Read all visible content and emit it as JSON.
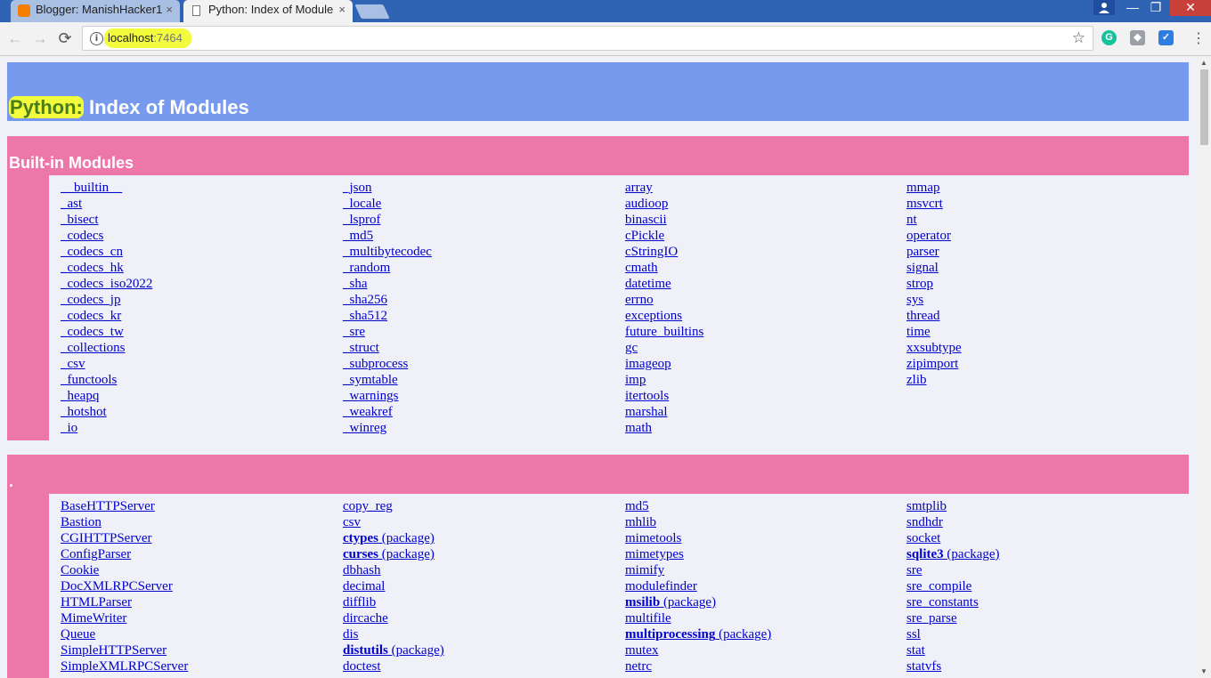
{
  "browser": {
    "tabs": [
      {
        "title": "Blogger: ManishHacker1",
        "close": "×",
        "active": false
      },
      {
        "title": "Python: Index of Module",
        "close": "×",
        "active": true
      }
    ],
    "window_controls": {
      "minimize": "—",
      "maximize": "❐",
      "close": "✕"
    },
    "url_host": "localhost",
    "url_port": ":7464",
    "nav": {
      "back": "←",
      "forward": "→",
      "reload": "⟳"
    },
    "star": "☆",
    "menu": "⋮",
    "info_glyph": "i",
    "extensions": [
      {
        "name": "grammarly-icon",
        "color": "#15c39a",
        "glyph": "G"
      },
      {
        "name": "extension-icon",
        "color": "#9aa0a6",
        "glyph": "◆"
      },
      {
        "name": "checkmark-extension-icon",
        "color": "#2f7de1",
        "glyph": "✓"
      }
    ],
    "colors": {
      "tab_strip": "#2f63b4",
      "highlight": "#f2fb3c"
    }
  },
  "page": {
    "title_highlight": "Python:",
    "title_rest": " Index of Modules",
    "colors": {
      "heading": "#7799ee",
      "section": "#ee77aa",
      "link": "#0000cc",
      "background": "#f0f0f8"
    },
    "builtin": {
      "heading": "Built-in Modules",
      "columns": [
        [
          {
            "name": "__builtin__"
          },
          {
            "name": "_ast"
          },
          {
            "name": "_bisect"
          },
          {
            "name": "_codecs"
          },
          {
            "name": "_codecs_cn"
          },
          {
            "name": "_codecs_hk"
          },
          {
            "name": "_codecs_iso2022"
          },
          {
            "name": "_codecs_jp"
          },
          {
            "name": "_codecs_kr"
          },
          {
            "name": "_codecs_tw"
          },
          {
            "name": "_collections"
          },
          {
            "name": "_csv"
          },
          {
            "name": "_functools"
          },
          {
            "name": "_heapq"
          },
          {
            "name": "_hotshot"
          },
          {
            "name": "_io"
          }
        ],
        [
          {
            "name": "_json"
          },
          {
            "name": "_locale"
          },
          {
            "name": "_lsprof"
          },
          {
            "name": "_md5"
          },
          {
            "name": "_multibytecodec"
          },
          {
            "name": "_random"
          },
          {
            "name": "_sha"
          },
          {
            "name": "_sha256"
          },
          {
            "name": "_sha512"
          },
          {
            "name": "_sre"
          },
          {
            "name": "_struct"
          },
          {
            "name": "_subprocess"
          },
          {
            "name": "_symtable"
          },
          {
            "name": "_warnings"
          },
          {
            "name": "_weakref"
          },
          {
            "name": "_winreg"
          }
        ],
        [
          {
            "name": "array"
          },
          {
            "name": "audioop"
          },
          {
            "name": "binascii"
          },
          {
            "name": "cPickle"
          },
          {
            "name": "cStringIO"
          },
          {
            "name": "cmath"
          },
          {
            "name": "datetime"
          },
          {
            "name": "errno"
          },
          {
            "name": "exceptions"
          },
          {
            "name": "future_builtins"
          },
          {
            "name": "gc"
          },
          {
            "name": "imageop"
          },
          {
            "name": "imp"
          },
          {
            "name": "itertools"
          },
          {
            "name": "marshal"
          },
          {
            "name": "math"
          }
        ],
        [
          {
            "name": "mmap"
          },
          {
            "name": "msvcrt"
          },
          {
            "name": "nt"
          },
          {
            "name": "operator"
          },
          {
            "name": "parser"
          },
          {
            "name": "signal"
          },
          {
            "name": "strop"
          },
          {
            "name": "sys"
          },
          {
            "name": "thread"
          },
          {
            "name": "time"
          },
          {
            "name": "xxsubtype"
          },
          {
            "name": "zipimport"
          },
          {
            "name": "zlib"
          }
        ]
      ]
    },
    "path_section": {
      "heading": ".",
      "package_suffix": " (package)",
      "columns": [
        [
          {
            "name": "BaseHTTPServer"
          },
          {
            "name": "Bastion"
          },
          {
            "name": "CGIHTTPServer"
          },
          {
            "name": "ConfigParser"
          },
          {
            "name": "Cookie"
          },
          {
            "name": "DocXMLRPCServer"
          },
          {
            "name": "HTMLParser"
          },
          {
            "name": "MimeWriter"
          },
          {
            "name": "Queue"
          },
          {
            "name": "SimpleHTTPServer"
          },
          {
            "name": "SimpleXMLRPCServer"
          }
        ],
        [
          {
            "name": "copy_reg"
          },
          {
            "name": "csv"
          },
          {
            "name": "ctypes",
            "pkg": true
          },
          {
            "name": "curses",
            "pkg": true
          },
          {
            "name": "dbhash"
          },
          {
            "name": "decimal"
          },
          {
            "name": "difflib"
          },
          {
            "name": "dircache"
          },
          {
            "name": "dis"
          },
          {
            "name": "distutils",
            "pkg": true
          },
          {
            "name": "doctest"
          }
        ],
        [
          {
            "name": "md5"
          },
          {
            "name": "mhlib"
          },
          {
            "name": "mimetools"
          },
          {
            "name": "mimetypes"
          },
          {
            "name": "mimify"
          },
          {
            "name": "modulefinder"
          },
          {
            "name": "msilib",
            "pkg": true
          },
          {
            "name": "multifile"
          },
          {
            "name": "multiprocessing",
            "pkg": true
          },
          {
            "name": "mutex"
          },
          {
            "name": "netrc"
          }
        ],
        [
          {
            "name": "smtplib"
          },
          {
            "name": "sndhdr"
          },
          {
            "name": "socket"
          },
          {
            "name": "sqlite3",
            "pkg": true
          },
          {
            "name": "sre"
          },
          {
            "name": "sre_compile"
          },
          {
            "name": "sre_constants"
          },
          {
            "name": "sre_parse"
          },
          {
            "name": "ssl"
          },
          {
            "name": "stat"
          },
          {
            "name": "statvfs"
          }
        ]
      ]
    }
  }
}
